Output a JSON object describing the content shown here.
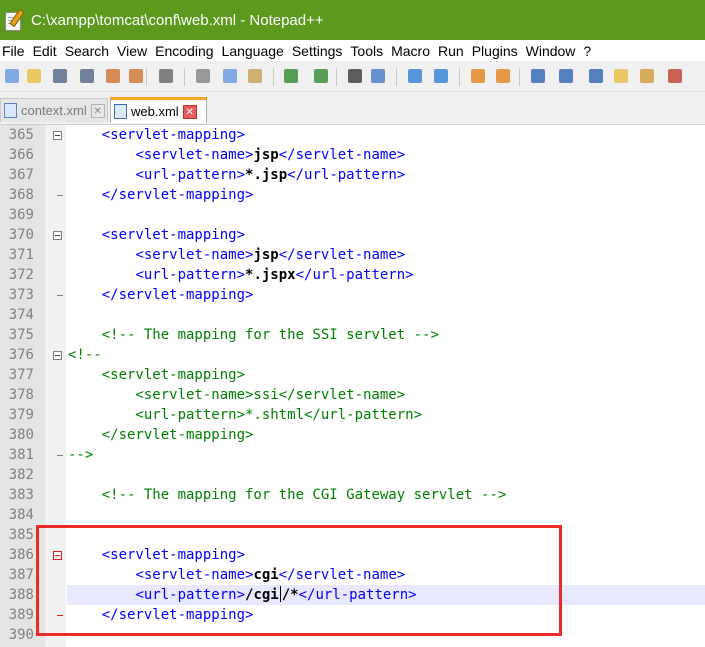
{
  "window": {
    "title": "C:\\xampp\\tomcat\\conf\\web.xml - Notepad++"
  },
  "menu": [
    "File",
    "Edit",
    "Search",
    "View",
    "Encoding",
    "Language",
    "Settings",
    "Tools",
    "Macro",
    "Run",
    "Plugins",
    "Window",
    "?"
  ],
  "toolbar": {
    "icons": [
      "new-file-icon",
      "open-file-icon",
      "save-icon",
      "save-all-icon",
      "close-icon",
      "close-all-icon",
      "print-icon",
      "cut-icon",
      "copy-icon",
      "paste-icon",
      "undo-icon",
      "redo-icon",
      "find-icon",
      "replace-icon",
      "zoom-in-icon",
      "zoom-out-icon",
      "sync-vertical-icon",
      "sync-horizontal-icon",
      "word-wrap-icon",
      "show-all-chars-icon",
      "indent-guide-icon",
      "folder-as-workspace-icon",
      "document-map-icon",
      "function-list-icon"
    ]
  },
  "tabs": [
    {
      "label": "context.xml",
      "active": false,
      "close": "✕"
    },
    {
      "label": "web.xml",
      "active": true,
      "close": "✕"
    }
  ],
  "editor": {
    "lines": [
      {
        "n": "365",
        "parts": [
          [
            "i",
            "    "
          ],
          [
            "t",
            "<servlet-mapping>"
          ]
        ]
      },
      {
        "n": "366",
        "parts": [
          [
            "i",
            "        "
          ],
          [
            "t",
            "<servlet-name>"
          ],
          [
            "v",
            "jsp"
          ],
          [
            "t",
            "</servlet-name>"
          ]
        ]
      },
      {
        "n": "367",
        "parts": [
          [
            "i",
            "        "
          ],
          [
            "t",
            "<url-pattern>"
          ],
          [
            "v",
            "*.jsp"
          ],
          [
            "t",
            "</url-pattern>"
          ]
        ]
      },
      {
        "n": "368",
        "parts": [
          [
            "i",
            "    "
          ],
          [
            "t",
            "</servlet-mapping>"
          ]
        ]
      },
      {
        "n": "369",
        "parts": []
      },
      {
        "n": "370",
        "parts": [
          [
            "i",
            "    "
          ],
          [
            "t",
            "<servlet-mapping>"
          ]
        ]
      },
      {
        "n": "371",
        "parts": [
          [
            "i",
            "        "
          ],
          [
            "t",
            "<servlet-name>"
          ],
          [
            "v",
            "jsp"
          ],
          [
            "t",
            "</servlet-name>"
          ]
        ]
      },
      {
        "n": "372",
        "parts": [
          [
            "i",
            "        "
          ],
          [
            "t",
            "<url-pattern>"
          ],
          [
            "v",
            "*.jspx"
          ],
          [
            "t",
            "</url-pattern>"
          ]
        ]
      },
      {
        "n": "373",
        "parts": [
          [
            "i",
            "    "
          ],
          [
            "t",
            "</servlet-mapping>"
          ]
        ]
      },
      {
        "n": "374",
        "parts": []
      },
      {
        "n": "375",
        "parts": [
          [
            "i",
            "    "
          ],
          [
            "c",
            "<!-- The mapping for the SSI servlet -->"
          ]
        ]
      },
      {
        "n": "376",
        "parts": [
          [
            "c",
            "<!--"
          ]
        ]
      },
      {
        "n": "377",
        "parts": [
          [
            "c",
            "    <servlet-mapping>"
          ]
        ]
      },
      {
        "n": "378",
        "parts": [
          [
            "c",
            "        <servlet-name>ssi</servlet-name>"
          ]
        ]
      },
      {
        "n": "379",
        "parts": [
          [
            "c",
            "        <url-pattern>*.shtml</url-pattern>"
          ]
        ]
      },
      {
        "n": "380",
        "parts": [
          [
            "c",
            "    </servlet-mapping>"
          ]
        ]
      },
      {
        "n": "381",
        "parts": [
          [
            "c",
            "-->"
          ]
        ]
      },
      {
        "n": "382",
        "parts": []
      },
      {
        "n": "383",
        "parts": [
          [
            "i",
            "    "
          ],
          [
            "c",
            "<!-- The mapping for the CGI Gateway servlet -->"
          ]
        ]
      },
      {
        "n": "384",
        "parts": []
      },
      {
        "n": "385",
        "parts": []
      },
      {
        "n": "386",
        "parts": [
          [
            "i",
            "    "
          ],
          [
            "t",
            "<servlet-mapping>"
          ]
        ]
      },
      {
        "n": "387",
        "parts": [
          [
            "i",
            "        "
          ],
          [
            "t",
            "<servlet-name>"
          ],
          [
            "v",
            "cgi"
          ],
          [
            "t",
            "</servlet-name>"
          ]
        ]
      },
      {
        "n": "388",
        "parts": [
          [
            "i",
            "        "
          ],
          [
            "t",
            "<url-pattern>"
          ],
          [
            "v",
            "/cgi"
          ],
          [
            "k",
            ""
          ],
          [
            "v",
            "/*"
          ],
          [
            "t",
            "</url-pattern>"
          ]
        ]
      },
      {
        "n": "389",
        "parts": [
          [
            "i",
            "    "
          ],
          [
            "t",
            "</servlet-mapping>"
          ]
        ]
      },
      {
        "n": "390",
        "parts": []
      }
    ],
    "current_line": "388"
  }
}
